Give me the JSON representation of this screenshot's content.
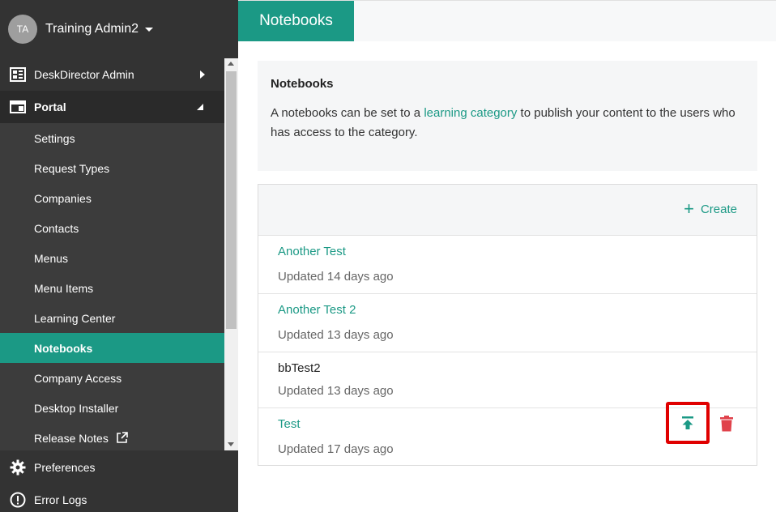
{
  "user": {
    "initials": "TA",
    "name": "Training Admin2"
  },
  "sidebar": {
    "top_items": [
      {
        "label": "DeskDirector Admin",
        "icon": "dashboard-icon"
      },
      {
        "label": "Portal",
        "icon": "portal-icon"
      }
    ],
    "portal_items": [
      {
        "label": "Settings"
      },
      {
        "label": "Request Types"
      },
      {
        "label": "Companies"
      },
      {
        "label": "Contacts"
      },
      {
        "label": "Menus"
      },
      {
        "label": "Menu Items"
      },
      {
        "label": "Learning Center"
      },
      {
        "label": "Notebooks",
        "active": true
      },
      {
        "label": "Company Access"
      },
      {
        "label": "Desktop Installer"
      },
      {
        "label": "Release Notes",
        "icon": "external-link-icon"
      }
    ],
    "bottom_items": [
      {
        "label": "Preferences",
        "icon": "gear-icon"
      },
      {
        "label": "Error Logs",
        "icon": "alert-circle-icon"
      }
    ]
  },
  "page": {
    "tab_title": "Notebooks"
  },
  "info": {
    "title": "Notebooks",
    "text_before": "A notebooks can be set to a ",
    "link_text": "learning category",
    "text_after": " to publish your content to the users who has access to the category."
  },
  "list": {
    "create_label": "Create",
    "items": [
      {
        "name": "Another Test",
        "updated": "Updated 14 days ago",
        "is_link": true
      },
      {
        "name": "Another Test 2",
        "updated": "Updated 13 days ago",
        "is_link": true
      },
      {
        "name": "bbTest2",
        "updated": "Updated 13 days ago",
        "is_link": false
      },
      {
        "name": "Test",
        "updated": "Updated 17 days ago",
        "is_link": true
      }
    ]
  },
  "colors": {
    "accent": "#1b9985",
    "sidebar": "#333333",
    "delete": "#e0424b",
    "highlight": "#e00000"
  }
}
